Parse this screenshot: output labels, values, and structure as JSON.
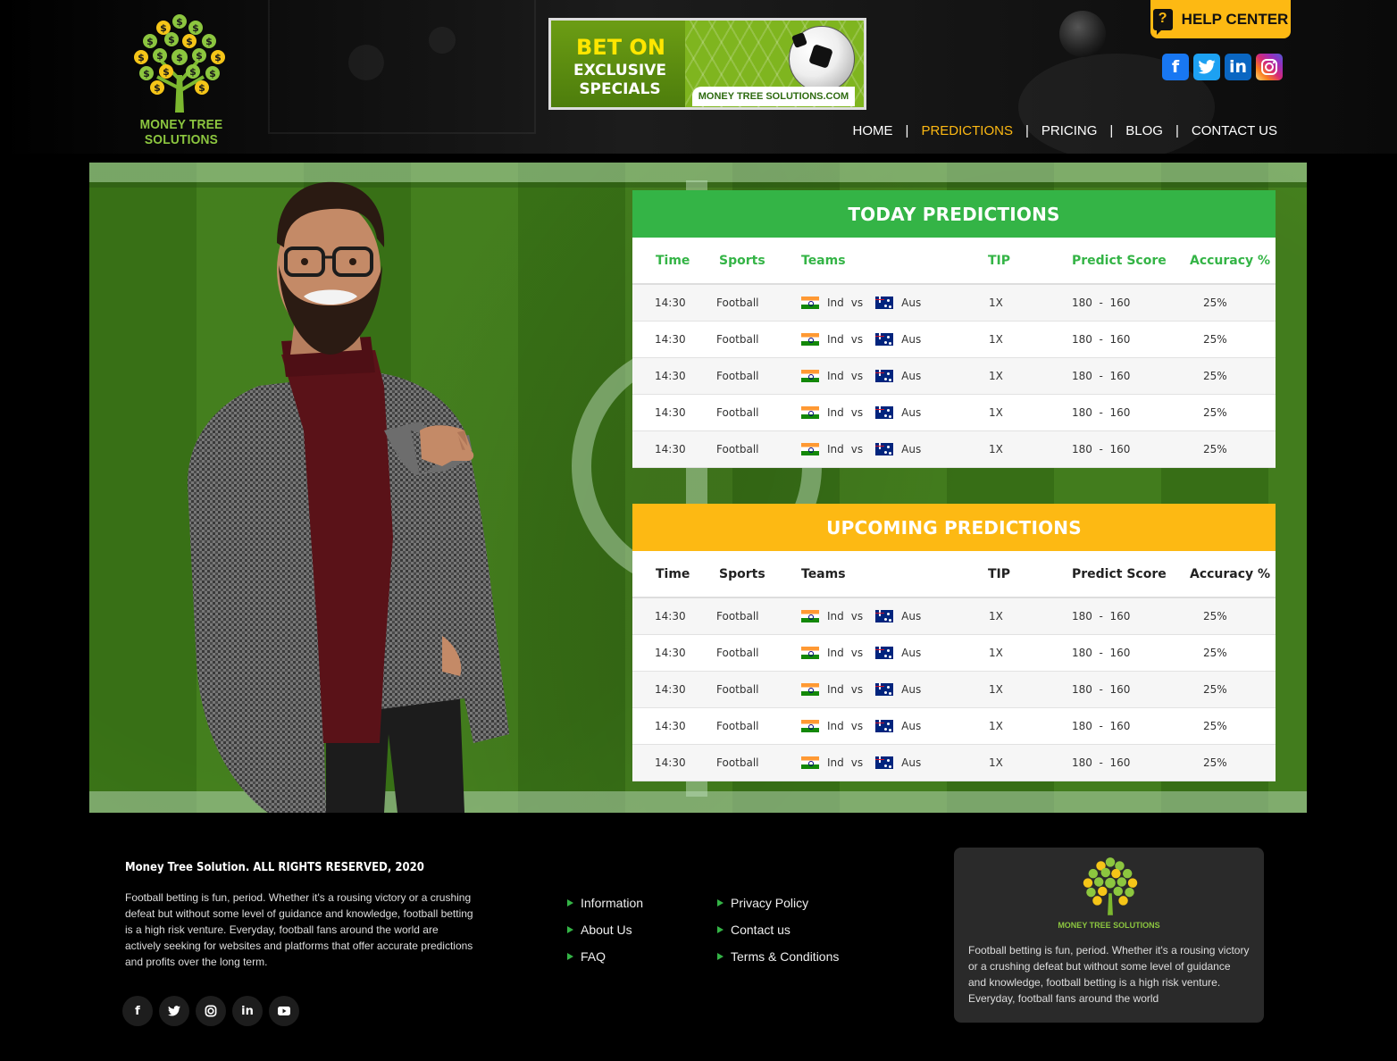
{
  "brand": {
    "name": "MONEY TREE SOLUTIONS"
  },
  "banner": {
    "line1": "BET ON",
    "line2": "EXCLUSIVE SPECIALS",
    "site": "MONEY TREE SOLUTIONS.COM"
  },
  "help": {
    "label": "HELP CENTER"
  },
  "social_top": [
    {
      "icon": "facebook-icon",
      "glyph": "f"
    },
    {
      "icon": "twitter-icon",
      "glyph": "t"
    },
    {
      "icon": "linkedin-icon",
      "glyph": "in"
    },
    {
      "icon": "instagram-icon",
      "glyph": "◎"
    }
  ],
  "nav": {
    "home": "HOME",
    "predictions": "PREDICTIONS",
    "pricing": "PRICING",
    "blog": "BLOG",
    "contact": "CONTACT US",
    "sep": "|"
  },
  "today": {
    "title": "TODAY PREDICTIONS",
    "columns": [
      "Time",
      "Sports",
      "Teams",
      "TIP",
      "Predict Score",
      "Accuracy %"
    ],
    "rows": [
      {
        "time": "14:30",
        "sport": "Football",
        "team1": "Ind",
        "vs": "vs",
        "team2": "Aus",
        "tip": "1X",
        "score": "180  -  160",
        "accuracy": "25%"
      },
      {
        "time": "14:30",
        "sport": "Football",
        "team1": "Ind",
        "vs": "vs",
        "team2": "Aus",
        "tip": "1X",
        "score": "180  -  160",
        "accuracy": "25%"
      },
      {
        "time": "14:30",
        "sport": "Football",
        "team1": "Ind",
        "vs": "vs",
        "team2": "Aus",
        "tip": "1X",
        "score": "180  -  160",
        "accuracy": "25%"
      },
      {
        "time": "14:30",
        "sport": "Football",
        "team1": "Ind",
        "vs": "vs",
        "team2": "Aus",
        "tip": "1X",
        "score": "180  -  160",
        "accuracy": "25%"
      },
      {
        "time": "14:30",
        "sport": "Football",
        "team1": "Ind",
        "vs": "vs",
        "team2": "Aus",
        "tip": "1X",
        "score": "180  -  160",
        "accuracy": "25%"
      }
    ]
  },
  "upcoming": {
    "title": "UPCOMING PREDICTIONS",
    "columns": [
      "Time",
      "Sports",
      "Teams",
      "TIP",
      "Predict Score",
      "Accuracy %"
    ],
    "rows": [
      {
        "time": "14:30",
        "sport": "Football",
        "team1": "Ind",
        "vs": "vs",
        "team2": "Aus",
        "tip": "1X",
        "score": "180  -  160",
        "accuracy": "25%"
      },
      {
        "time": "14:30",
        "sport": "Football",
        "team1": "Ind",
        "vs": "vs",
        "team2": "Aus",
        "tip": "1X",
        "score": "180  -  160",
        "accuracy": "25%"
      },
      {
        "time": "14:30",
        "sport": "Football",
        "team1": "Ind",
        "vs": "vs",
        "team2": "Aus",
        "tip": "1X",
        "score": "180  -  160",
        "accuracy": "25%"
      },
      {
        "time": "14:30",
        "sport": "Football",
        "team1": "Ind",
        "vs": "vs",
        "team2": "Aus",
        "tip": "1X",
        "score": "180  -  160",
        "accuracy": "25%"
      },
      {
        "time": "14:30",
        "sport": "Football",
        "team1": "Ind",
        "vs": "vs",
        "team2": "Aus",
        "tip": "1X",
        "score": "180  -  160",
        "accuracy": "25%"
      }
    ]
  },
  "footer": {
    "copyright": "Money Tree Solution. ALL RIGHTS RESERVED, 2020",
    "about": "Football betting is fun, period. Whether it's a rousing victory or a crushing defeat but without some level of guidance and knowledge, football betting is a high risk venture. Everyday, football fans around the world are actively seeking for websites and platforms that offer accurate predictions and profits over the long term.",
    "social": [
      {
        "icon": "facebook-icon",
        "glyph": "f"
      },
      {
        "icon": "twitter-icon",
        "glyph": "t"
      },
      {
        "icon": "instagram-icon",
        "glyph": "◎"
      },
      {
        "icon": "linkedin-icon",
        "glyph": "in"
      },
      {
        "icon": "youtube-icon",
        "glyph": "▶"
      }
    ],
    "links_col1": [
      "Information",
      "About Us",
      "FAQ"
    ],
    "links_col2": [
      "Privacy Policy",
      "Contact us",
      "Terms & Conditions"
    ],
    "card_brand": "MONEY TREE SOLUTIONS",
    "card_text": "Football betting is fun, period. Whether it's a rousing victory or a crushing defeat but without some level of guidance and knowledge, football betting is a high risk venture. Everyday, football fans around the world"
  },
  "colors": {
    "green": "#34b446",
    "yellow": "#fdb913",
    "brand_green": "#8cc63f"
  }
}
